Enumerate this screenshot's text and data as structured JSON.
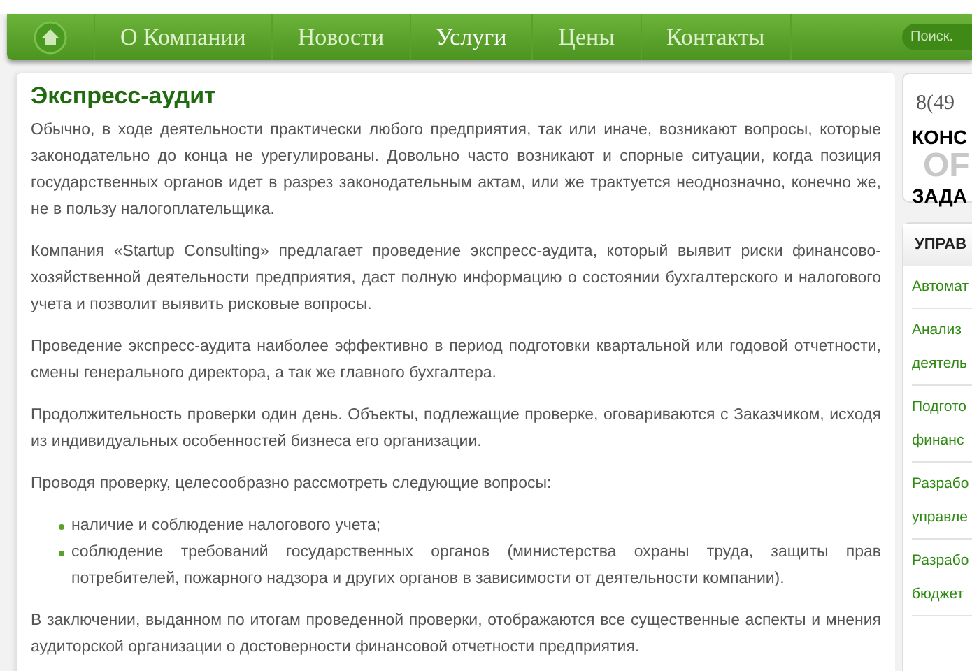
{
  "nav": {
    "items": [
      {
        "label": "О Компании",
        "selected": false
      },
      {
        "label": "Новости",
        "selected": false
      },
      {
        "label": "Услуги",
        "selected": true
      },
      {
        "label": "Цены",
        "selected": false
      },
      {
        "label": "Контакты",
        "selected": false
      }
    ],
    "search": {
      "placeholder": "Поиск."
    }
  },
  "article": {
    "title": "Экспресс-аудит",
    "blocks": [
      {
        "kind": "paragraph",
        "text": "Обычно, в ходе деятельности практически любого предприятия, так или иначе, возникают вопросы, которые законодательно до конца не урегулированы. Довольно часто возникают и спорные ситуации, когда позиция государственных органов идет в разрез законодательным актам, или же трактуется неоднозначно, конечно же, не в пользу налогоплательщика."
      },
      {
        "kind": "paragraph",
        "text": "Компания «Startup Consulting» предлагает проведение экспресс-аудита, который выявит риски финансово-хозяйственной деятельности предприятия, даст полную информацию о состоянии бухгалтерского и налогового учета и позволит выявить рисковые вопросы."
      },
      {
        "kind": "paragraph",
        "text": "Проведение экспресс-аудита наиболее эффективно в период подготовки квартальной или годовой отчетности, смены генерального директора, а так же главного бухгалтера."
      },
      {
        "kind": "paragraph",
        "text": "Продолжительность проверки один день. Объекты, подлежащие проверке, оговариваются с Заказчиком, исходя из индивидуальных особенностей бизнеса его организации."
      },
      {
        "kind": "paragraph",
        "text": "Проводя проверку, целесообразно рассмотреть следующие вопросы:"
      },
      {
        "kind": "list",
        "items": [
          "наличие и соблюдение налогового учета;",
          "соблюдение требований государственных органов (министерства охраны труда, защиты прав потребителей, пожарного надзора и других органов в зависимости от деятельности компании)."
        ]
      },
      {
        "kind": "paragraph",
        "text": "В заключении, выданном по итогам проведенной проверки, отображаются все существенные аспекты и мнения аудиторской организации о достоверности финансовой отчетности предприятия."
      }
    ]
  },
  "contact_card": {
    "phone": "8(49",
    "line_1": "КОНС",
    "line_2": "OF",
    "line_3": "ЗАДА"
  },
  "services": {
    "title": "УПРАВ",
    "items": [
      {
        "lines": [
          "Автомат"
        ]
      },
      {
        "lines": [
          "Анализ",
          "деятель"
        ]
      },
      {
        "lines": [
          "Подгото",
          "финанс"
        ]
      },
      {
        "lines": [
          "Разрабо",
          "управле"
        ]
      },
      {
        "lines": [
          "Разрабо",
          "бюджет"
        ]
      }
    ]
  }
}
